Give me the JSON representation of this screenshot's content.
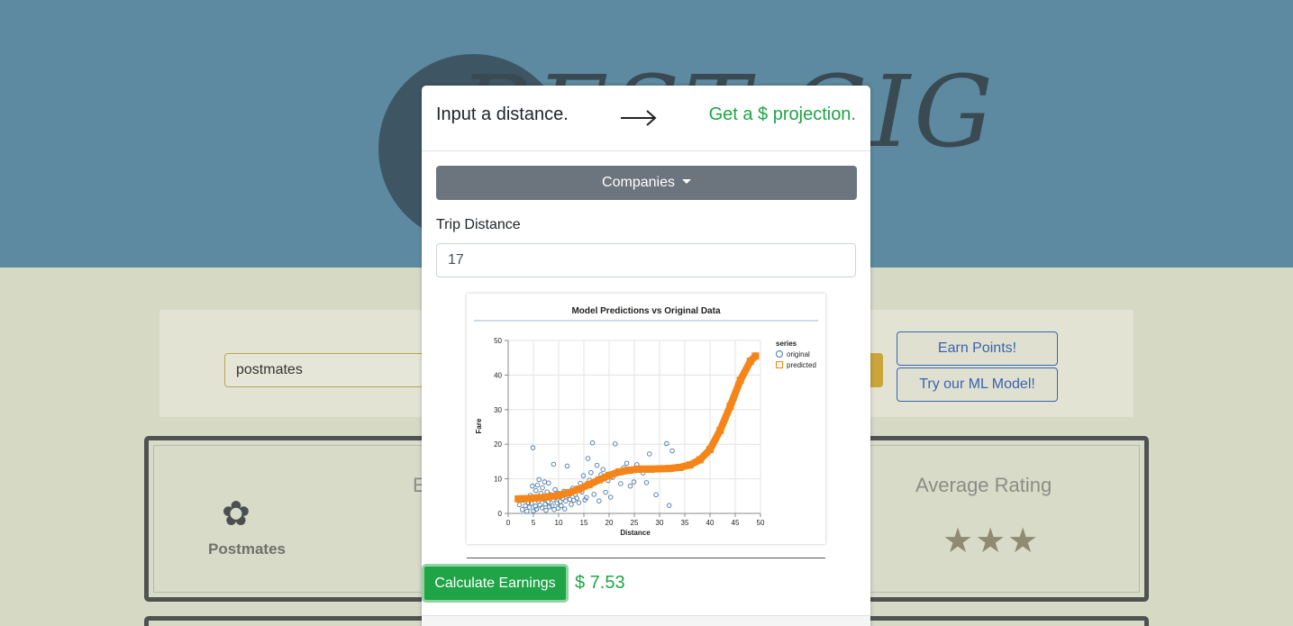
{
  "background": {
    "logo_text": "BEST GIG",
    "search_value": "postmates",
    "earn_points_label": "Earn Points!",
    "try_ml_label": "Try our ML Model!",
    "company_name": "Postmates",
    "column_title": "E",
    "rating_title": "Average Rating",
    "stars": "★★★"
  },
  "modal": {
    "header_left": "Input a distance.",
    "header_arrow": "arrow-right-icon",
    "header_right": "Get a $ projection.",
    "companies_label": "Companies",
    "trip_distance_label": "Trip Distance",
    "trip_distance_value": "17",
    "calculate_label": "Calculate Earnings",
    "result_text": "$ 7.53"
  },
  "colors": {
    "accent_green": "#1fa447",
    "secondary_gray": "#6c757d",
    "original_series": "#4c78a8",
    "predicted_series": "#f58518"
  },
  "chart_data": {
    "type": "scatter",
    "title": "Model Predictions vs Original Data",
    "xlabel": "Distance",
    "ylabel": "Fare",
    "xlim": [
      0,
      50
    ],
    "ylim": [
      0,
      50
    ],
    "x_ticks": [
      0,
      5,
      10,
      15,
      20,
      25,
      30,
      35,
      40,
      45,
      50
    ],
    "y_ticks": [
      0,
      10,
      20,
      30,
      40,
      50
    ],
    "grid": true,
    "legend": {
      "title": "series",
      "position": "right",
      "entries": [
        "original",
        "predicted"
      ]
    },
    "series": [
      {
        "name": "original",
        "mark": "circle",
        "points": [
          [
            2.2,
            2.5
          ],
          [
            2.8,
            1.1
          ],
          [
            3,
            3.8
          ],
          [
            3.4,
            2.2
          ],
          [
            3.7,
            0.6
          ],
          [
            4,
            3.1
          ],
          [
            4.2,
            1.8
          ],
          [
            4.4,
            5.2
          ],
          [
            4.6,
            2.9
          ],
          [
            4.8,
            7.9
          ],
          [
            4.9,
            19
          ],
          [
            5,
            0.7
          ],
          [
            5.2,
            4.4
          ],
          [
            5.4,
            2.1
          ],
          [
            5.5,
            6.6
          ],
          [
            5.6,
            1.2
          ],
          [
            5.8,
            8.2
          ],
          [
            6,
            3.5
          ],
          [
            6.1,
            9.8
          ],
          [
            6.3,
            2.4
          ],
          [
            6.5,
            5.8
          ],
          [
            6.7,
            1.6
          ],
          [
            6.8,
            7.4
          ],
          [
            7,
            4.1
          ],
          [
            7.2,
            9.1
          ],
          [
            7.4,
            2.7
          ],
          [
            7.5,
            0.9
          ],
          [
            7.7,
            6.2
          ],
          [
            7.9,
            3.3
          ],
          [
            8,
            8.8
          ],
          [
            8.2,
            1.9
          ],
          [
            8.4,
            5.4
          ],
          [
            8.5,
            4.7
          ],
          [
            8.7,
            2.2
          ],
          [
            8.9,
            3.9
          ],
          [
            9,
            14.2
          ],
          [
            9.1,
            1.1
          ],
          [
            9.3,
            6.9
          ],
          [
            9.5,
            4.6
          ],
          [
            9.7,
            3
          ],
          [
            9.9,
            1.5
          ],
          [
            10,
            5.8
          ],
          [
            10.3,
            3.4
          ],
          [
            10.5,
            2.2
          ],
          [
            10.8,
            4.3
          ],
          [
            11,
            6.4
          ],
          [
            11.2,
            1.3
          ],
          [
            11.4,
            3.6
          ],
          [
            11.7,
            13.7
          ],
          [
            11.9,
            5.1
          ],
          [
            12.2,
            4.1
          ],
          [
            12.5,
            2.6
          ],
          [
            12.8,
            7.3
          ],
          [
            13,
            3.8
          ],
          [
            13.3,
            5.5
          ],
          [
            13.6,
            4.4
          ],
          [
            14,
            3.1
          ],
          [
            14.3,
            8.7
          ],
          [
            14.6,
            6.2
          ],
          [
            14.9,
            10.9
          ],
          [
            15.2,
            3.9
          ],
          [
            15.5,
            4.6
          ],
          [
            15.8,
            15.9
          ],
          [
            16.1,
            9.6
          ],
          [
            16.4,
            11.8
          ],
          [
            16.7,
            20.4
          ],
          [
            17,
            5.5
          ],
          [
            17.3,
            8.8
          ],
          [
            17.6,
            13.9
          ],
          [
            18,
            3.6
          ],
          [
            18.4,
            11.2
          ],
          [
            18.8,
            12.7
          ],
          [
            19.3,
            6.1
          ],
          [
            19.8,
            9.5
          ],
          [
            20.3,
            4.7
          ],
          [
            20.7,
            10.4
          ],
          [
            21.2,
            20.1
          ],
          [
            21.7,
            12.3
          ],
          [
            22.3,
            8.6
          ],
          [
            22.9,
            13.2
          ],
          [
            23.5,
            14.5
          ],
          [
            24.2,
            7.9
          ],
          [
            24.9,
            9.1
          ],
          [
            25.5,
            14.1
          ],
          [
            26,
            12.9
          ],
          [
            26.7,
            11.7
          ],
          [
            27.4,
            8.9
          ],
          [
            28,
            17.2
          ],
          [
            28.6,
            12.4
          ],
          [
            29.3,
            5.4
          ],
          [
            30.5,
            13.1
          ],
          [
            31.4,
            20.2
          ],
          [
            31.9,
            2.3
          ],
          [
            32.5,
            18.1
          ],
          [
            44.8,
            32.8
          ]
        ]
      },
      {
        "name": "predicted",
        "mark": "square",
        "points": [
          [
            2,
            4.2
          ],
          [
            4,
            4.3
          ],
          [
            6,
            4.5
          ],
          [
            8,
            4.8
          ],
          [
            10,
            5.2
          ],
          [
            12,
            6
          ],
          [
            14,
            7
          ],
          [
            16,
            8.3
          ],
          [
            18,
            9.7
          ],
          [
            20,
            11
          ],
          [
            22,
            12
          ],
          [
            24,
            12.5
          ],
          [
            26,
            12.8
          ],
          [
            28,
            12.8
          ],
          [
            30,
            12.9
          ],
          [
            32,
            13
          ],
          [
            34,
            13.3
          ],
          [
            36,
            14
          ],
          [
            38,
            15.5
          ],
          [
            40,
            18.5
          ],
          [
            42,
            24
          ],
          [
            44,
            31
          ],
          [
            46,
            38.5
          ],
          [
            48,
            44
          ],
          [
            49,
            45.5
          ]
        ]
      }
    ]
  }
}
